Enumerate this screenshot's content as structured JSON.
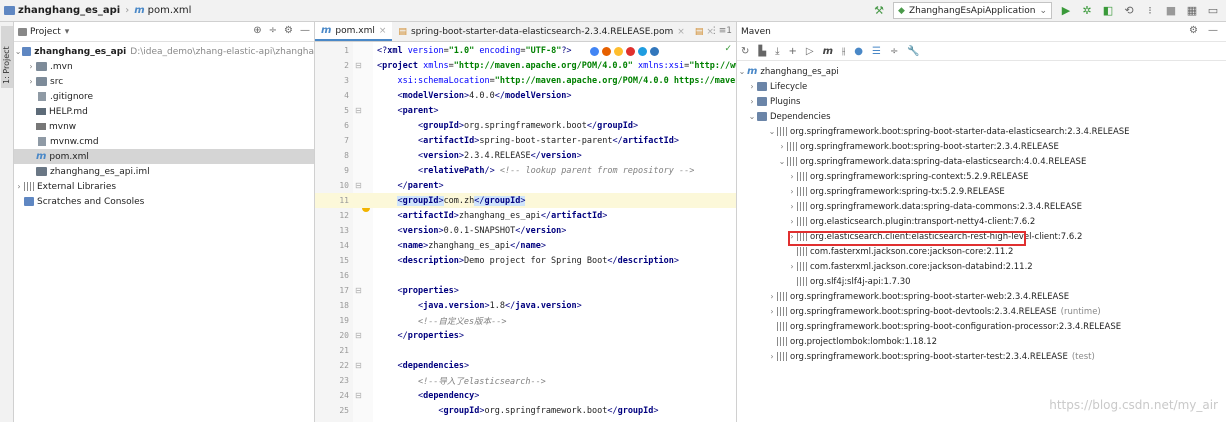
{
  "nav": {
    "project": "zhanghang_es_api",
    "file": "pom.xml",
    "run_config": "ZhanghangEsApiApplication"
  },
  "side_stripe": {
    "label": "1: Project"
  },
  "project_panel": {
    "title": "Project",
    "root": {
      "name": "zhanghang_es_api",
      "path": "D:\\idea_demo\\zhang-elastic-api\\zhangha"
    },
    "items": [
      {
        "label": ".mvn",
        "icon": "folder-icon"
      },
      {
        "label": "src",
        "icon": "folder-icon"
      },
      {
        "label": ".gitignore",
        "icon": "file-icon"
      },
      {
        "label": "HELP.md",
        "icon": "markdown-icon"
      },
      {
        "label": "mvnw",
        "icon": "file-icon"
      },
      {
        "label": "mvnw.cmd",
        "icon": "file-icon"
      },
      {
        "label": "pom.xml",
        "icon": "maven-icon"
      },
      {
        "label": "zhanghang_es_api.iml",
        "icon": "module-icon"
      },
      {
        "label": "External Libraries",
        "icon": "library-icon"
      },
      {
        "label": "Scratches and Consoles",
        "icon": "scratch-icon"
      }
    ]
  },
  "editor": {
    "tabs": [
      {
        "label": "pom.xml"
      },
      {
        "label": "spring-boot-starter-data-elasticsearch-2.3.4.RELEASE.pom"
      }
    ],
    "line_numbers": [
      "1",
      "2",
      "3",
      "4",
      "5",
      "6",
      "7",
      "8",
      "9",
      "10",
      "11",
      "12",
      "13",
      "14",
      "15",
      "16",
      "17",
      "18",
      "19",
      "20",
      "21",
      "22",
      "23",
      "24",
      "25"
    ]
  },
  "maven": {
    "title": "Maven",
    "root": "zhanghang_es_api",
    "lifecycle": "Lifecycle",
    "plugins": "Plugins",
    "dependencies": "Dependencies",
    "deps": [
      "org.springframework.boot:spring-boot-starter-data-elasticsearch:2.3.4.RELEASE",
      "org.springframework.boot:spring-boot-starter:2.3.4.RELEASE",
      "org.springframework.data:spring-data-elasticsearch:4.0.4.RELEASE",
      "org.springframework:spring-context:5.2.9.RELEASE",
      "org.springframework:spring-tx:5.2.9.RELEASE",
      "org.springframework.data:spring-data-commons:2.3.4.RELEASE",
      "org.elasticsearch.plugin:transport-netty4-client:7.6.2",
      "org.elasticsearch.client:elasticsearch-rest-high-level-client:7.6.2",
      "com.fasterxml.jackson.core:jackson-core:2.11.2",
      "com.fasterxml.jackson.core:jackson-databind:2.11.2",
      "org.slf4j:slf4j-api:1.7.30",
      "org.springframework.boot:spring-boot-starter-web:2.3.4.RELEASE",
      "org.springframework.boot:spring-boot-devtools:2.3.4.RELEASE",
      "org.springframework.boot:spring-boot-configuration-processor:2.3.4.RELEASE",
      "org.projectlombok:lombok:1.18.12",
      "org.springframework.boot:spring-boot-starter-test:2.3.4.RELEASE"
    ],
    "scope_runtime": "(runtime)",
    "scope_test": "(test)"
  },
  "watermark": "https://blog.csdn.net/my_air"
}
